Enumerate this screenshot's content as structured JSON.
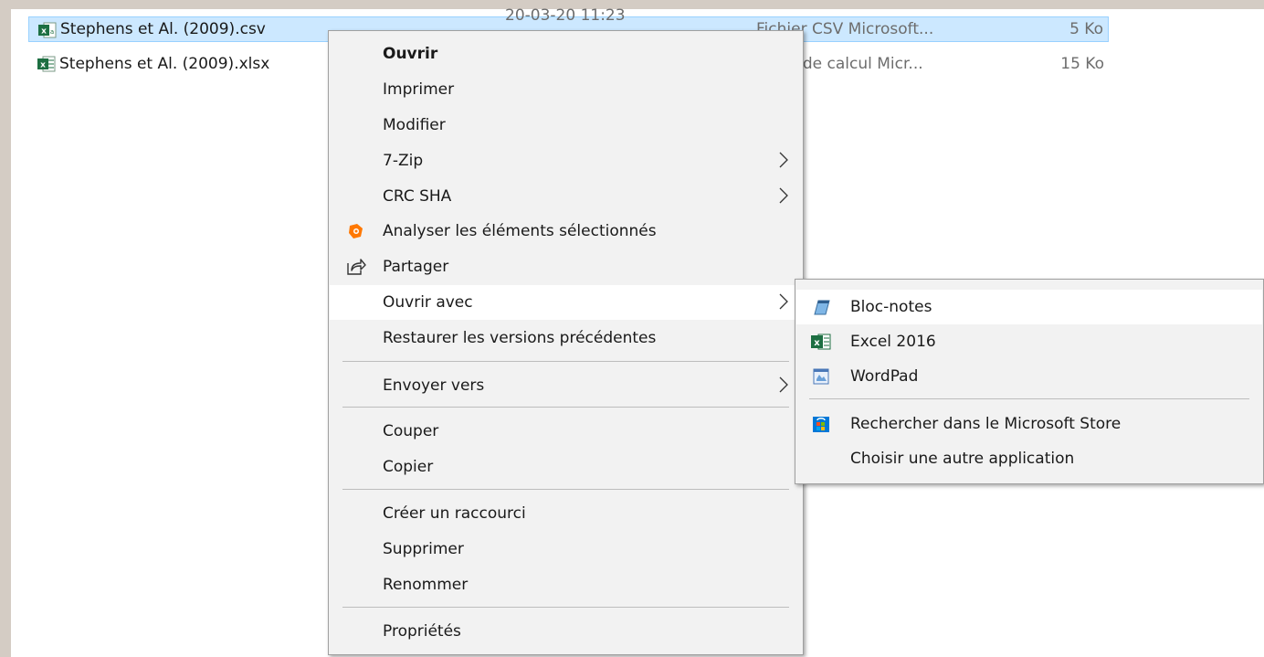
{
  "files": [
    {
      "name": "Stephens et Al. (2009).csv",
      "date": "20-03-20 11:23",
      "type": "Fichier CSV Microsoft...",
      "size": "5 Ko",
      "icon": "excel-csv-icon"
    },
    {
      "name": "Stephens et Al. (2009).xlsx",
      "type": "Feuille de calcul Micr...",
      "type_visible": "e de calcul Micr...",
      "size": "15 Ko",
      "icon": "excel-xlsx-icon"
    }
  ],
  "context_menu": {
    "items": [
      {
        "label": "Ouvrir",
        "bold": true
      },
      {
        "label": "Imprimer"
      },
      {
        "label": "Modifier"
      },
      {
        "label": "7-Zip",
        "submenu": true
      },
      {
        "label": "CRC SHA",
        "submenu": true
      },
      {
        "label": "Analyser les éléments sélectionnés",
        "icon": "avast-icon"
      },
      {
        "label": "Partager",
        "icon": "share-icon"
      },
      {
        "label": "Ouvrir avec",
        "submenu": true,
        "highlighted": true
      },
      {
        "label": "Restaurer les versions précédentes"
      },
      {
        "label": "Envoyer vers",
        "submenu": true
      },
      {
        "label": "Couper"
      },
      {
        "label": "Copier"
      },
      {
        "label": "Créer un raccourci"
      },
      {
        "label": "Supprimer"
      },
      {
        "label": "Renommer"
      },
      {
        "label": "Propriétés"
      }
    ]
  },
  "open_with_menu": {
    "items": [
      {
        "label": "Bloc-notes",
        "icon": "notepad-icon",
        "highlighted": true
      },
      {
        "label": "Excel 2016",
        "icon": "excel-icon"
      },
      {
        "label": "WordPad",
        "icon": "wordpad-icon"
      },
      {
        "label": "Rechercher dans le Microsoft Store",
        "icon": "store-icon"
      },
      {
        "label": "Choisir une autre application"
      }
    ]
  },
  "colors": {
    "selection": "#cce8ff",
    "menu_bg": "#f2f2f2",
    "excel_green": "#1d6f42",
    "avast_orange": "#ff7800",
    "store_blue": "#0078d7"
  }
}
